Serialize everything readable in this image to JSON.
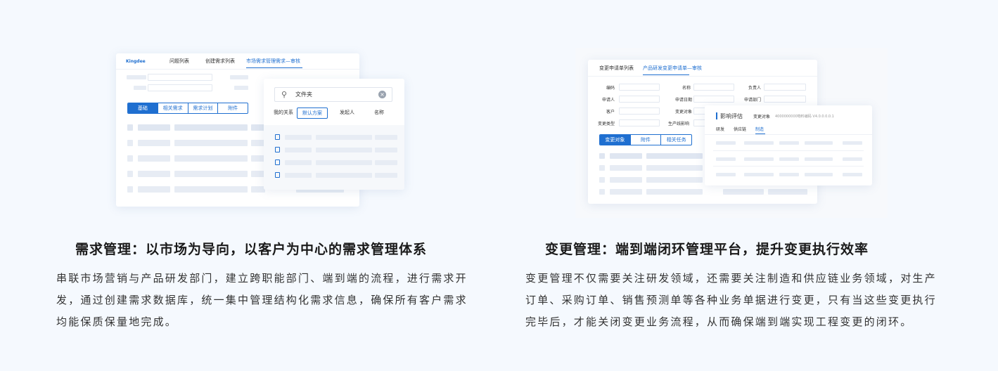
{
  "left": {
    "mock": {
      "logo": "Kingdee",
      "tabs": [
        "问题列表",
        "创建需求列表",
        "市场需求管理需求—审核"
      ],
      "segments": [
        "基础",
        "相关需求",
        "需求计划",
        "附件"
      ],
      "popup": {
        "search_text": "文件夹",
        "filters": [
          "我的关系",
          "默认方案",
          "发起人",
          "名称"
        ]
      }
    },
    "heading": "需求管理：以市场为导向，以客户为中心的需求管理体系",
    "paragraph": "串联市场营销与产品研发部门，建立跨职能部门、端到端的流程，进行需求开发，通过创建需求数据库，统一集中管理结构化需求信息，确保所有客户需求均能保质保量地完成。"
  },
  "right": {
    "mock": {
      "tabs": [
        "变更申请单列表",
        "产品研发变更申请单—审核"
      ],
      "form_labels": [
        "编码",
        "名称",
        "负责人",
        "申请人",
        "申请日期",
        "申请部门",
        "客户",
        "变更对象",
        "变更类型",
        "生产线影响"
      ],
      "segments": [
        "变更对象",
        "附件",
        "相关任务"
      ],
      "popup": {
        "title": "影响评估",
        "label": "变更对象",
        "value": "4000000000物料编码 V4.0.0.0.0.1",
        "tabs": [
          "研发",
          "供应链",
          "制造"
        ]
      }
    },
    "heading": "变更管理：端到端闭环管理平台，提升变更执行效率",
    "paragraph": "变更管理不仅需要关注研发领域，还需要关注制造和供应链业务领域，对生产订单、采购订单、销售预测单等各种业务单据进行变更，只有当这些变更执行完毕后，才能关闭变更业务流程，从而确保端到端实现工程变更的闭环。"
  }
}
